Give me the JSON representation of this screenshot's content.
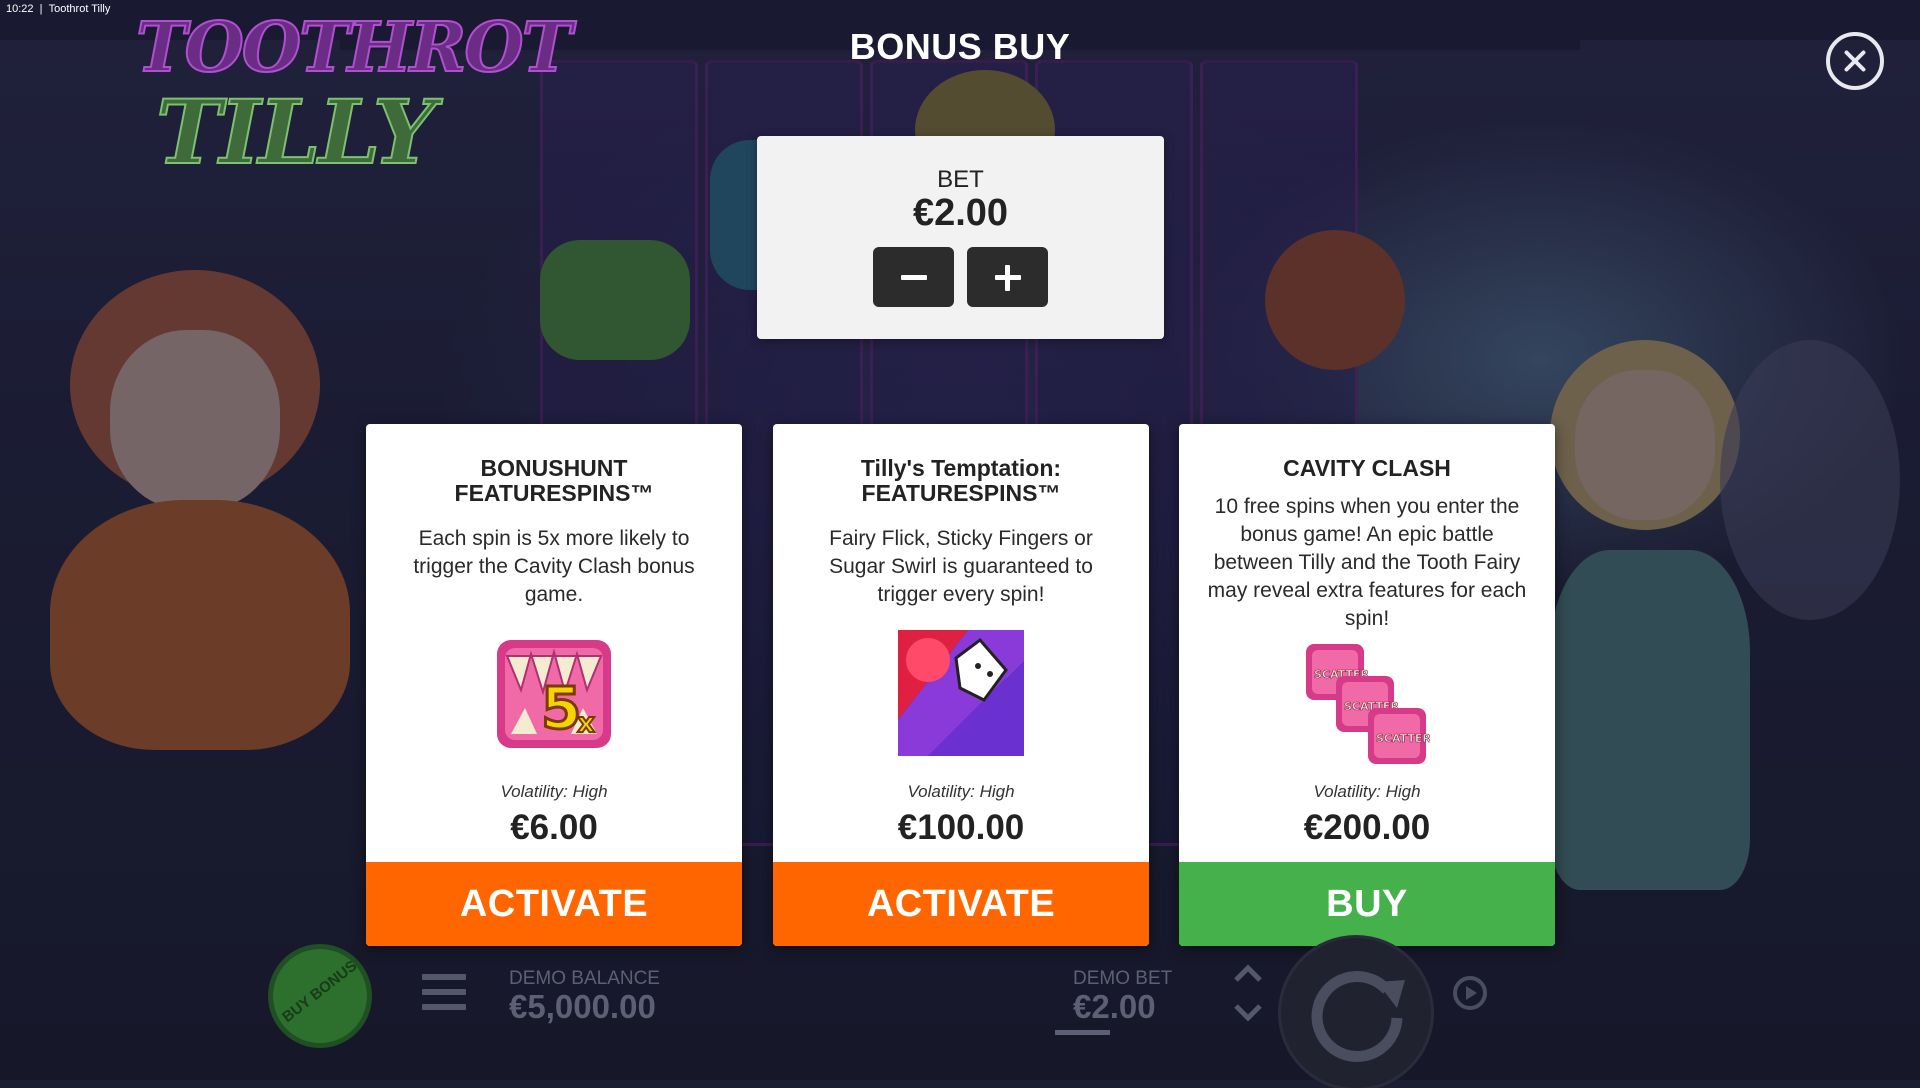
{
  "window": {
    "time": "10:22",
    "title": "Toothrot Tilly"
  },
  "logo": {
    "line1": "TOOTHROT",
    "line2": "TILLY"
  },
  "modal": {
    "title": "BONUS BUY",
    "bet": {
      "label": "BET",
      "value": "€2.00"
    }
  },
  "cards": [
    {
      "title": "BONUSHUNT FEATURESPINS™",
      "description": "Each spin is 5x more likely to trigger the Cavity Clash bonus game.",
      "image_icon": "5x-scatter-multiplier-icon",
      "volatility": "Volatility: High",
      "price": "€6.00",
      "button": "ACTIVATE",
      "button_color": "#ff6600"
    },
    {
      "title": "Tilly's Temptation: FEATURESPINS™",
      "description": "Fairy Flick, Sticky Fingers or Sugar Swirl is guaranteed to trigger every spin!",
      "image_icon": "feature-collage-icon",
      "volatility": "Volatility: High",
      "price": "€100.00",
      "button": "ACTIVATE",
      "button_color": "#ff6600"
    },
    {
      "title": "CAVITY CLASH",
      "description": "10 free spins when you enter the bonus game! An epic battle between Tilly and the Tooth Fairy may reveal extra features for each spin!",
      "image_icon": "three-scatters-icon",
      "scatter_text": "SCATTER",
      "volatility": "Volatility: High",
      "price": "€200.00",
      "button": "BUY",
      "button_color": "#45b14b"
    }
  ],
  "bottom_bar": {
    "buy_bonus": "BUY BONUS",
    "balance_label": "DEMO BALANCE",
    "balance_value": "€5,000.00",
    "bet_label": "DEMO BET",
    "bet_value": "€2.00"
  }
}
